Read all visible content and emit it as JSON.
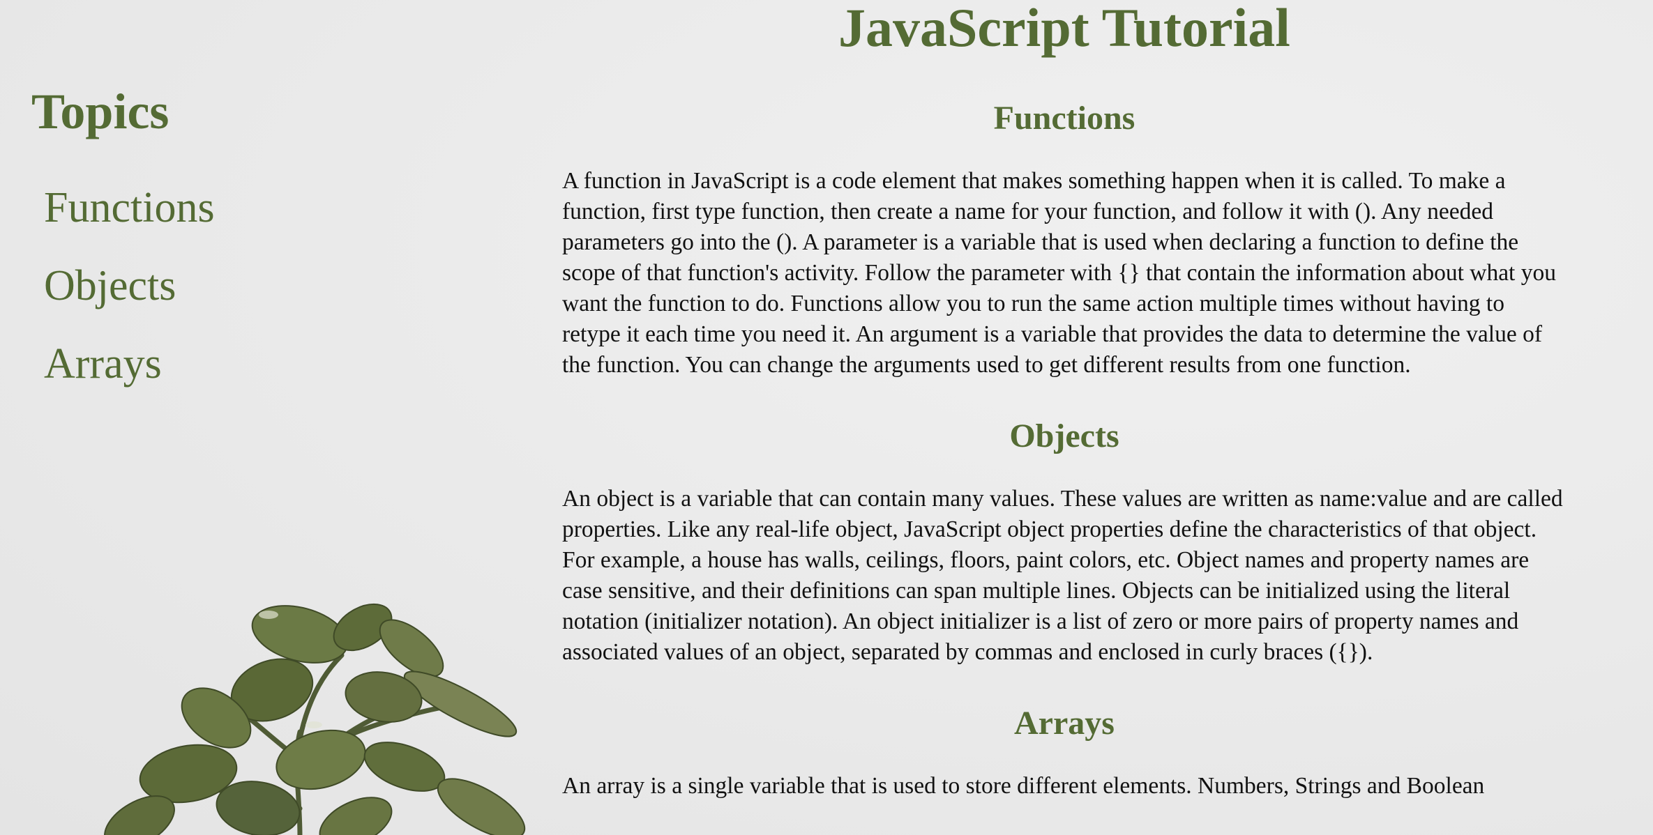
{
  "page_title": "JavaScript Tutorial",
  "sidebar": {
    "title": "Topics",
    "items": [
      {
        "label": "Functions"
      },
      {
        "label": "Objects"
      },
      {
        "label": "Arrays"
      }
    ]
  },
  "sections": {
    "functions": {
      "title": "Functions",
      "text": "A function in JavaScript is a code element that makes something happen when it is called. To make a function, first type function, then create a name for your function, and follow it with (). Any needed parameters go into the (). A parameter is a variable that is used when declaring a function to define the scope of that function's activity. Follow the parameter with {} that contain the information about what you want the function to do. Functions allow you to run the same action multiple times without having to retype it each time you need it. An argument is a variable that provides the data to determine the value of the function. You can change the arguments used to get different results from one function."
    },
    "objects": {
      "title": "Objects",
      "text": "An object is a variable that can contain many values. These values are written as name:value and are called properties. Like any real-life object, JavaScript object properties define the characteristics of that object. For example, a house has walls, ceilings, floors, paint colors, etc. Object names and property names are case sensitive, and their definitions can span multiple lines. Objects can be initialized using the literal notation (initializer notation). An object initializer is a list of zero or more pairs of property names and associated values of an object, separated by commas and enclosed in curly braces ({})."
    },
    "arrays": {
      "title": "Arrays",
      "text": "An array is a single variable that is used to store different elements. Numbers, Strings and Boolean"
    }
  },
  "colors": {
    "heading": "#546b34",
    "body_text": "#111111",
    "background": "#ebebeb",
    "leaf": "#5f6d3f"
  },
  "decor": {
    "plant_icon": "succulent-plant-image"
  }
}
